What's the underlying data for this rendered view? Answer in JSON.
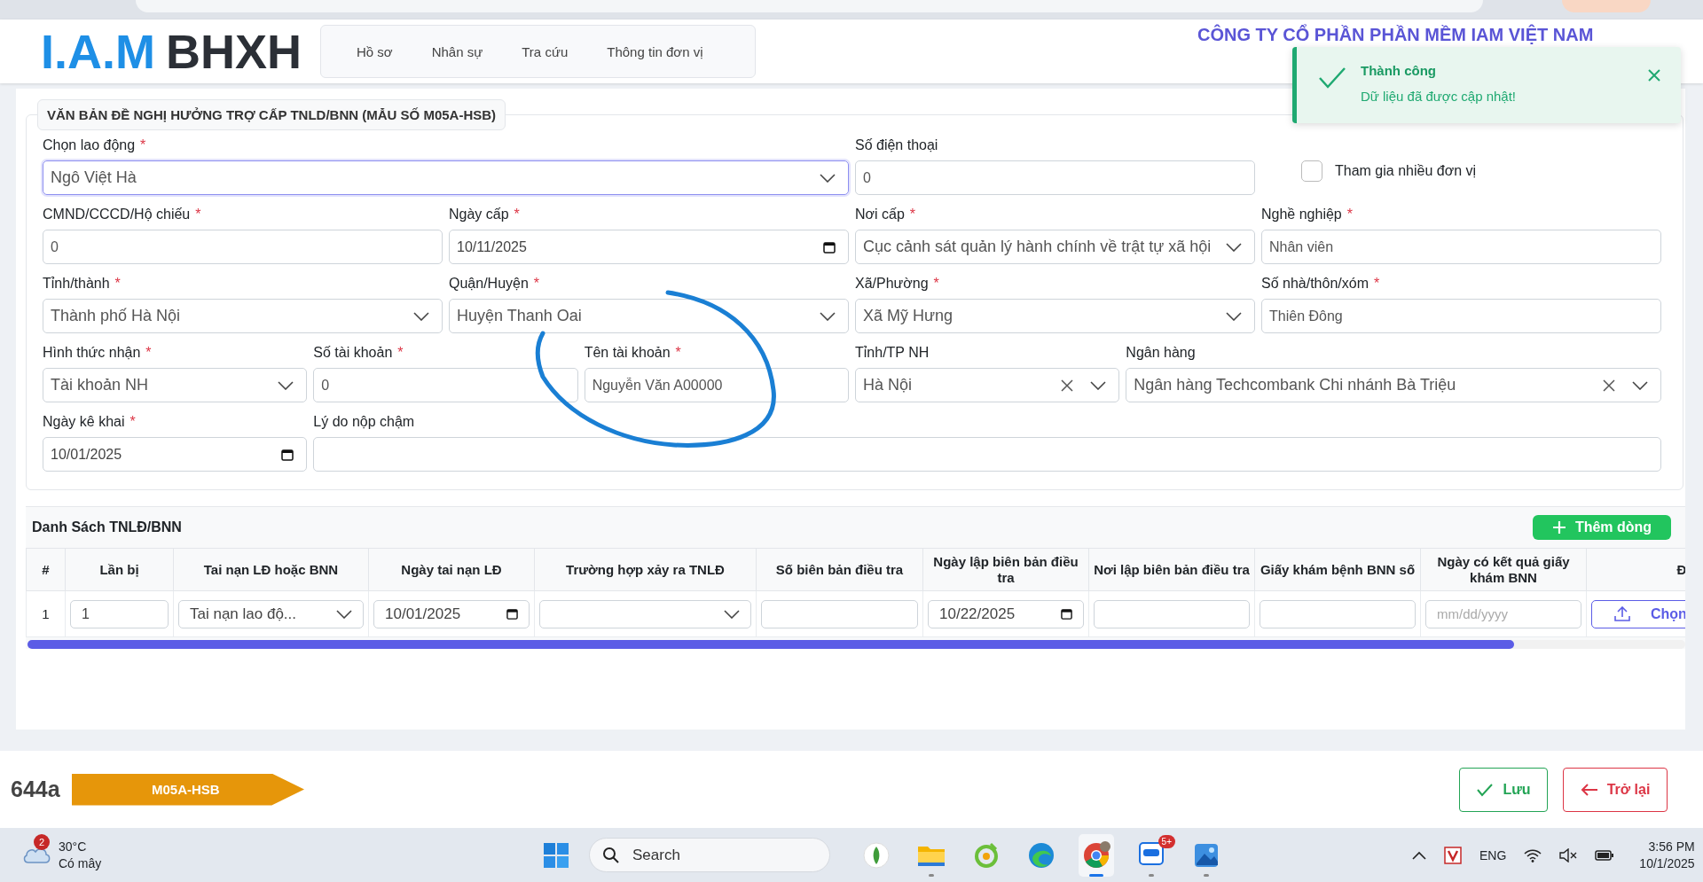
{
  "header": {
    "logo": {
      "brand": "I.A.M",
      "name": "BHXH"
    },
    "nav": [
      {
        "label": "Hồ sơ"
      },
      {
        "label": "Nhân sự"
      },
      {
        "label": "Tra cứu"
      },
      {
        "label": "Thông tin đơn vị"
      }
    ],
    "company": "CÔNG TY CỔ PHẦN PHẦN MỀM IAM VIỆT NAM"
  },
  "toast": {
    "kind": "success",
    "title": "Thành công",
    "message": "Dữ liệu đã được cập nhật!"
  },
  "form": {
    "title": "VĂN BẢN ĐỀ NGHỊ HƯỞNG TRỢ CẤP TNLD/BNN (MẪU SỐ M05A-HSB)",
    "fields": [
      {
        "kind": "select",
        "label": "Chọn lao động",
        "mark": "*",
        "value": "Ngô Việt Hà",
        "focused": true
      },
      {
        "kind": "text",
        "label": "Số điện thoại",
        "value": "0",
        "focused": false
      },
      {
        "kind": "checkbox",
        "label": "Tham gia nhiều đơn vị",
        "checked": false
      },
      {
        "kind": "text",
        "label": "CMND/CCCD/Hộ chiếu",
        "mark": "*",
        "value": "0",
        "focused": false
      },
      {
        "kind": "date",
        "label": "Ngày cấp",
        "mark": "*",
        "value": "10/11/2025",
        "focused": false
      },
      {
        "kind": "select",
        "label": "Nơi cấp",
        "mark": "*",
        "value": "Cục cảnh sát quản lý hành chính về trật tự xã hội",
        "focused": false
      },
      {
        "kind": "text",
        "label": "Nghề nghiệp",
        "mark": "*",
        "value": "Nhân viên",
        "focused": false
      },
      {
        "kind": "select",
        "label": "Tỉnh/thành",
        "mark": "*",
        "value": "Thành phố Hà Nội",
        "focused": false
      },
      {
        "kind": "select",
        "label": "Quận/Huyện",
        "mark": "*",
        "value": "Huyện Thanh Oai",
        "focused": false
      },
      {
        "kind": "select",
        "label": "Xã/Phường",
        "mark": "*",
        "value": "Xã Mỹ Hưng",
        "focused": false
      },
      {
        "kind": "text",
        "label": "Số nhà/thôn/xóm",
        "mark": "*",
        "value": "Thiên Đông",
        "focused": false
      },
      {
        "kind": "select",
        "label": "Hình thức nhận",
        "mark": "*",
        "value": "Tài khoản NH",
        "focused": false
      },
      {
        "kind": "text",
        "label": "Số tài khoản",
        "mark": "*",
        "value": "0",
        "focused": false
      },
      {
        "kind": "text",
        "label": "Tên tài khoản",
        "mark": "*",
        "value": "Nguyễn Văn A00000",
        "focused": false
      },
      {
        "kind": "clearable",
        "label": "Tỉnh/TP NH",
        "value": "Hà Nội",
        "focused": false
      },
      {
        "kind": "clearable",
        "label": "Ngân hàng",
        "value": "Ngân hàng Techcombank Chi nhánh Bà Triệu",
        "focused": false
      },
      {
        "kind": "date",
        "label": "Ngày kê khai",
        "mark": "*",
        "value": "10/01/2025",
        "focused": false
      },
      {
        "kind": "text",
        "label": "Lý do nộp chậm",
        "focused": false
      }
    ]
  },
  "table": {
    "title": "Danh Sách TNLĐ/BNN",
    "add_button": "Thêm dòng",
    "columns": [
      "#",
      "Lần bị",
      "Tai nạn LĐ hoặc BNN",
      "Ngày tai nạn LĐ",
      "Trường hợp xảy ra TNLĐ",
      "Số biên bản điều tra",
      "Ngày lập biên bản điều tra",
      "Nơi lập biên bản điều tra",
      "Giấy khám bệnh BNN số",
      "Ngày có kết quả giấy khám BNN",
      "Đ"
    ],
    "rows": [
      {
        "cells": [
          {
            "kind": "index",
            "value": "1"
          },
          {
            "kind": "text",
            "value": "1"
          },
          {
            "kind": "select",
            "value": "Tai nạn lao độ..."
          },
          {
            "kind": "date",
            "value": "10/01/2025"
          },
          {
            "kind": "select"
          },
          {
            "kind": "text"
          },
          {
            "kind": "date",
            "value": "10/22/2025"
          },
          {
            "kind": "text"
          },
          {
            "kind": "text"
          },
          {
            "kind": "text",
            "placeholder": "mm/dd/yyyy"
          },
          {
            "kind": "upload",
            "value": "Chọn"
          }
        ]
      }
    ]
  },
  "footer": {
    "code": "644a",
    "form_tag": "M05A-HSB",
    "buttons": [
      {
        "kind": "save",
        "label": "Lưu"
      },
      {
        "kind": "back",
        "label": "Trở lại"
      }
    ]
  },
  "taskbar": {
    "weather": {
      "badge": "2",
      "temp": "30°C",
      "desc": "Có mây"
    },
    "search": {
      "placeholder": "Search"
    },
    "apps": [
      {
        "kind": "leaf",
        "running": false,
        "active": false
      },
      {
        "kind": "folder",
        "running": true,
        "active": false
      },
      {
        "kind": "ring",
        "running": false,
        "active": false
      },
      {
        "kind": "edge",
        "running": false,
        "active": false
      },
      {
        "kind": "chrome",
        "running": true,
        "active": true
      },
      {
        "kind": "chat",
        "running": true,
        "active": false,
        "badge": "5+"
      },
      {
        "kind": "photos",
        "running": true,
        "active": false
      }
    ],
    "language": "ENG",
    "time": "3:56 PM",
    "date": "10/1/2025"
  }
}
